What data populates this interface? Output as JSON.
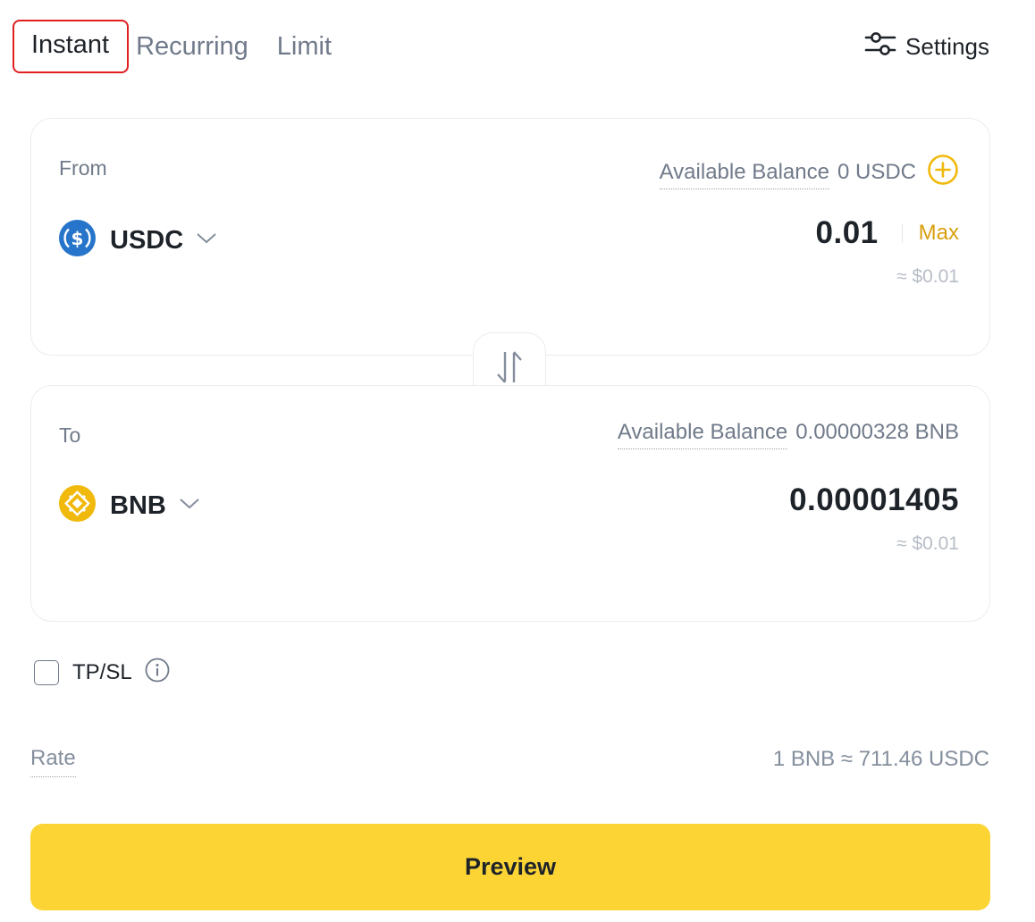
{
  "tabs": {
    "instant": "Instant",
    "recurring": "Recurring",
    "limit": "Limit"
  },
  "settings": {
    "label": "Settings",
    "icon": "sliders-icon"
  },
  "from": {
    "label": "From",
    "balance_label": "Available Balance",
    "balance_value": "0 USDC",
    "token": "USDC",
    "token_icon": "usdc-icon",
    "amount": "0.01",
    "max_label": "Max",
    "usd_value": "≈ $0.01"
  },
  "to": {
    "label": "To",
    "balance_label": "Available Balance",
    "balance_value": "0.00000328 BNB",
    "token": "BNB",
    "token_icon": "bnb-icon",
    "amount": "0.00001405",
    "usd_value": "≈ $0.01"
  },
  "tpsl": {
    "label": "TP/SL",
    "checked": false
  },
  "rate": {
    "label": "Rate",
    "value": "1 BNB ≈ 711.46 USDC"
  },
  "preview": {
    "label": "Preview"
  },
  "colors": {
    "accent": "#fcd535",
    "max_link": "#d89f0e",
    "active_tab_highlight": "#e02020",
    "usdc_blue": "#2775ca",
    "bnb_yellow": "#f0b90b"
  }
}
